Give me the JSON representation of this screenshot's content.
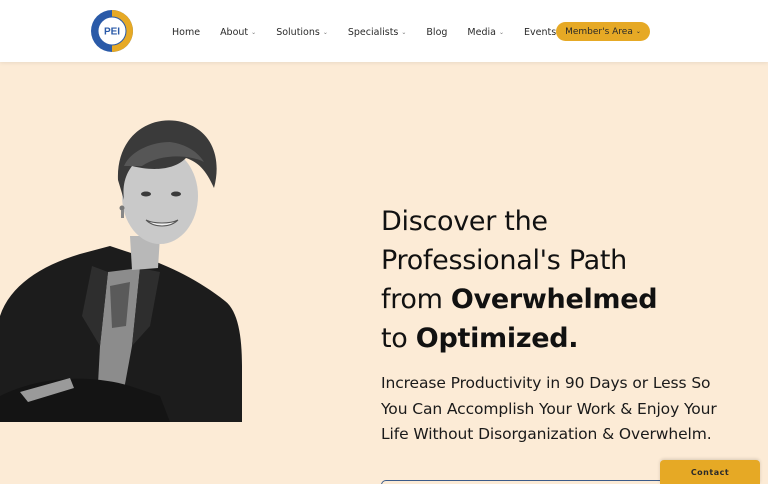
{
  "header": {
    "logo": {
      "text": "PEI",
      "ring_text": "PRODUCTIVE ENVIRONMENT INSTITUTE",
      "icon": "pei-logo"
    },
    "nav": [
      {
        "label": "Home",
        "dropdown": false
      },
      {
        "label": "About",
        "dropdown": true
      },
      {
        "label": "Solutions",
        "dropdown": true
      },
      {
        "label": "Specialists",
        "dropdown": true
      },
      {
        "label": "Blog",
        "dropdown": false
      },
      {
        "label": "Media",
        "dropdown": true
      },
      {
        "label": "Events",
        "dropdown": true
      }
    ],
    "member_button": {
      "label": "Member's Area",
      "dropdown": true
    }
  },
  "hero": {
    "headline": {
      "line1": "Discover the",
      "line2": "Professional's Path",
      "line3_prefix": "from ",
      "line3_bold": "Overwhelmed",
      "line4_prefix": "to ",
      "line4_bold": "Optimized."
    },
    "subtext": "Increase Productivity in 90 Days or Less So You Can Accomplish Your Work & Enjoy Your Life Without Disorganization & Overwhelm."
  },
  "contact_tab": {
    "label": "Contact"
  },
  "colors": {
    "accent": "#e6a925",
    "hero_bg": "#fcebd6",
    "logo_blue": "#2a5aa8",
    "logo_gold": "#e6a925"
  }
}
